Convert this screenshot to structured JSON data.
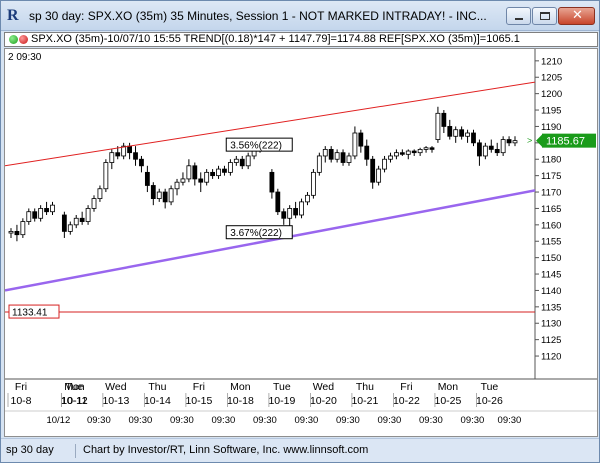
{
  "window": {
    "title": "sp 30 day: SPX.XO (35m) 35 Minutes, Session 1 - NOT MARKED INTRADAY! - INC...",
    "app_icon": "investor-rt-logo-icon"
  },
  "infobar": {
    "text": "SPX.XO (35m)-10/07/10 15:55  TREND[(0.18)*147 + 1147.79]=1174.88  REF[SPX.XO (35m)]=1065.1"
  },
  "footer": {
    "left": "sp 30 day",
    "right": "Chart by Investor/RT, Linn Software, Inc. www.linnsoft.com"
  },
  "chart_data": {
    "type": "candlestick",
    "symbol": "SPX.XO (35m)",
    "ylim": [
      1113,
      1213
    ],
    "y_ticks": [
      1120,
      1125,
      1130,
      1135,
      1140,
      1145,
      1150,
      1155,
      1160,
      1165,
      1170,
      1175,
      1180,
      1185,
      1190,
      1195,
      1200,
      1205,
      1210
    ],
    "top_left_label": "2  09:30",
    "last_price": 1185.67,
    "reference_line": {
      "value": 1133.41,
      "label": "1133.41",
      "color": "#d42020"
    },
    "channel_upper": {
      "start": 1178,
      "end": 1203.5,
      "color": "#e02020"
    },
    "channel_lower": {
      "start": 1140,
      "end": 1170.5,
      "color": "#9966ee"
    },
    "annotations": [
      {
        "text": "3.56%(222)",
        "x": 0.425,
        "y": 1184.3
      },
      {
        "text": "3.67%(222)",
        "x": 0.425,
        "y": 1157.6
      }
    ],
    "days": [
      {
        "dow": "Fri",
        "date": "10-8",
        "tick": "",
        "candles": [
          {
            "o": 1157.5,
            "h": 1159,
            "l": 1156,
            "c": 1158
          },
          {
            "o": 1158,
            "h": 1160,
            "l": 1155,
            "c": 1157
          },
          {
            "o": 1157,
            "h": 1162,
            "l": 1156,
            "c": 1161
          },
          {
            "o": 1161,
            "h": 1165,
            "l": 1160,
            "c": 1164
          },
          {
            "o": 1164,
            "h": 1165,
            "l": 1161,
            "c": 1162
          },
          {
            "o": 1162,
            "h": 1166,
            "l": 1161,
            "c": 1165
          },
          {
            "o": 1165,
            "h": 1167,
            "l": 1163,
            "c": 1164
          },
          {
            "o": 1164,
            "h": 1167,
            "l": 1163,
            "c": 1166
          }
        ]
      },
      {
        "dow": "Mon",
        "date": "10-11",
        "tick": "",
        "candles": []
      },
      {
        "dow": "Tue",
        "date": "10-12",
        "tick": "10/12",
        "candles": [
          {
            "o": 1163,
            "h": 1164,
            "l": 1156,
            "c": 1158
          },
          {
            "o": 1158,
            "h": 1161,
            "l": 1157,
            "c": 1160
          },
          {
            "o": 1160,
            "h": 1163,
            "l": 1159,
            "c": 1162
          },
          {
            "o": 1162,
            "h": 1164,
            "l": 1160,
            "c": 1161
          },
          {
            "o": 1161,
            "h": 1166,
            "l": 1160,
            "c": 1165
          },
          {
            "o": 1165,
            "h": 1169,
            "l": 1164,
            "c": 1168
          },
          {
            "o": 1168,
            "h": 1172,
            "l": 1167,
            "c": 1171
          }
        ]
      },
      {
        "dow": "Wed",
        "date": "10-13",
        "tick": "",
        "candles": [
          {
            "o": 1171,
            "h": 1180,
            "l": 1170,
            "c": 1179
          },
          {
            "o": 1179,
            "h": 1183,
            "l": 1177,
            "c": 1182
          },
          {
            "o": 1182,
            "h": 1184,
            "l": 1180,
            "c": 1181
          },
          {
            "o": 1181,
            "h": 1185,
            "l": 1180,
            "c": 1184
          },
          {
            "o": 1184,
            "h": 1185,
            "l": 1180,
            "c": 1182
          },
          {
            "o": 1182,
            "h": 1184,
            "l": 1178,
            "c": 1180
          },
          {
            "o": 1180,
            "h": 1181,
            "l": 1176,
            "c": 1178
          }
        ]
      },
      {
        "dow": "Thu",
        "date": "10-14",
        "tick": "",
        "candles": [
          {
            "o": 1176,
            "h": 1178,
            "l": 1170,
            "c": 1172
          },
          {
            "o": 1172,
            "h": 1173,
            "l": 1166,
            "c": 1168
          },
          {
            "o": 1168,
            "h": 1171,
            "l": 1167,
            "c": 1170
          },
          {
            "o": 1170,
            "h": 1171,
            "l": 1165,
            "c": 1167
          },
          {
            "o": 1167,
            "h": 1172,
            "l": 1166,
            "c": 1171
          },
          {
            "o": 1171,
            "h": 1174,
            "l": 1169,
            "c": 1173
          },
          {
            "o": 1173,
            "h": 1176,
            "l": 1172,
            "c": 1174
          }
        ]
      },
      {
        "dow": "Fri",
        "date": "10-15",
        "tick": "",
        "candles": [
          {
            "o": 1174,
            "h": 1180,
            "l": 1173,
            "c": 1178
          },
          {
            "o": 1178,
            "h": 1179,
            "l": 1172,
            "c": 1174
          },
          {
            "o": 1174,
            "h": 1176,
            "l": 1170,
            "c": 1173
          },
          {
            "o": 1173,
            "h": 1177,
            "l": 1172,
            "c": 1176
          },
          {
            "o": 1176,
            "h": 1177,
            "l": 1174,
            "c": 1175
          },
          {
            "o": 1175,
            "h": 1178,
            "l": 1174,
            "c": 1177
          },
          {
            "o": 1177,
            "h": 1178,
            "l": 1175,
            "c": 1176
          }
        ]
      },
      {
        "dow": "Mon",
        "date": "10-18",
        "tick": "",
        "candles": [
          {
            "o": 1176,
            "h": 1180,
            "l": 1175,
            "c": 1179
          },
          {
            "o": 1179,
            "h": 1181,
            "l": 1178,
            "c": 1180
          },
          {
            "o": 1180,
            "h": 1181,
            "l": 1177,
            "c": 1178
          },
          {
            "o": 1178,
            "h": 1182,
            "l": 1177,
            "c": 1181
          },
          {
            "o": 1181,
            "h": 1184,
            "l": 1180,
            "c": 1183
          },
          {
            "o": 1183,
            "h": 1185,
            "l": 1182,
            "c": 1184
          },
          {
            "o": 1184,
            "h": 1185,
            "l": 1183,
            "c": 1184.5
          }
        ]
      },
      {
        "dow": "Tue",
        "date": "10-19",
        "tick": "",
        "candles": [
          {
            "o": 1176,
            "h": 1177,
            "l": 1168,
            "c": 1170
          },
          {
            "o": 1170,
            "h": 1171,
            "l": 1163,
            "c": 1164
          },
          {
            "o": 1164,
            "h": 1165,
            "l": 1160,
            "c": 1162
          },
          {
            "o": 1162,
            "h": 1166,
            "l": 1159,
            "c": 1165
          },
          {
            "o": 1165,
            "h": 1167,
            "l": 1162,
            "c": 1163
          },
          {
            "o": 1163,
            "h": 1168,
            "l": 1162,
            "c": 1167
          },
          {
            "o": 1167,
            "h": 1170,
            "l": 1166,
            "c": 1169
          }
        ]
      },
      {
        "dow": "Wed",
        "date": "10-20",
        "tick": "",
        "candles": [
          {
            "o": 1169,
            "h": 1177,
            "l": 1168,
            "c": 1176
          },
          {
            "o": 1176,
            "h": 1182,
            "l": 1175,
            "c": 1181
          },
          {
            "o": 1181,
            "h": 1184,
            "l": 1179,
            "c": 1183
          },
          {
            "o": 1183,
            "h": 1184,
            "l": 1179,
            "c": 1180
          },
          {
            "o": 1180,
            "h": 1183,
            "l": 1179,
            "c": 1182
          },
          {
            "o": 1182,
            "h": 1183,
            "l": 1178,
            "c": 1179
          },
          {
            "o": 1179,
            "h": 1182,
            "l": 1178,
            "c": 1181
          }
        ]
      },
      {
        "dow": "Thu",
        "date": "10-21",
        "tick": "",
        "candles": [
          {
            "o": 1181,
            "h": 1190,
            "l": 1180,
            "c": 1188
          },
          {
            "o": 1188,
            "h": 1189,
            "l": 1182,
            "c": 1184
          },
          {
            "o": 1184,
            "h": 1186,
            "l": 1178,
            "c": 1180
          },
          {
            "o": 1180,
            "h": 1181,
            "l": 1171,
            "c": 1173
          },
          {
            "o": 1173,
            "h": 1178,
            "l": 1172,
            "c": 1177
          },
          {
            "o": 1177,
            "h": 1181,
            "l": 1176,
            "c": 1180
          },
          {
            "o": 1180,
            "h": 1182,
            "l": 1179,
            "c": 1181
          }
        ]
      },
      {
        "dow": "Fri",
        "date": "10-22",
        "tick": "",
        "candles": [
          {
            "o": 1181,
            "h": 1183,
            "l": 1180,
            "c": 1182
          },
          {
            "o": 1182,
            "h": 1183,
            "l": 1181,
            "c": 1181.5
          },
          {
            "o": 1181.5,
            "h": 1183,
            "l": 1180,
            "c": 1182.5
          },
          {
            "o": 1182.5,
            "h": 1183,
            "l": 1181,
            "c": 1182
          },
          {
            "o": 1182,
            "h": 1183.5,
            "l": 1181,
            "c": 1183
          },
          {
            "o": 1183,
            "h": 1184,
            "l": 1182,
            "c": 1183.5
          },
          {
            "o": 1183.5,
            "h": 1184,
            "l": 1182,
            "c": 1183
          }
        ]
      },
      {
        "dow": "Mon",
        "date": "10-25",
        "tick": "",
        "candles": [
          {
            "o": 1186,
            "h": 1196,
            "l": 1185,
            "c": 1194
          },
          {
            "o": 1194,
            "h": 1195,
            "l": 1188,
            "c": 1190
          },
          {
            "o": 1190,
            "h": 1192,
            "l": 1186,
            "c": 1187
          },
          {
            "o": 1187,
            "h": 1190,
            "l": 1185,
            "c": 1189
          },
          {
            "o": 1189,
            "h": 1190,
            "l": 1186,
            "c": 1187
          },
          {
            "o": 1187,
            "h": 1189,
            "l": 1185,
            "c": 1188
          },
          {
            "o": 1188,
            "h": 1189,
            "l": 1184,
            "c": 1185
          }
        ]
      },
      {
        "dow": "Tue",
        "date": "10-26",
        "tick": "",
        "candles": [
          {
            "o": 1185,
            "h": 1186,
            "l": 1178,
            "c": 1181
          },
          {
            "o": 1181,
            "h": 1185,
            "l": 1180,
            "c": 1184
          },
          {
            "o": 1184,
            "h": 1186,
            "l": 1182,
            "c": 1183
          },
          {
            "o": 1183,
            "h": 1185,
            "l": 1181,
            "c": 1182
          },
          {
            "o": 1182,
            "h": 1187,
            "l": 1181,
            "c": 1186
          },
          {
            "o": 1186,
            "h": 1187,
            "l": 1184,
            "c": 1185
          },
          {
            "o": 1185,
            "h": 1187,
            "l": 1184,
            "c": 1185.67
          }
        ]
      }
    ],
    "time_ticks": [
      "09:30",
      "09:30",
      "09:30",
      "09:30",
      "09:30",
      "09:30",
      "09:30",
      "09:30",
      "09:30",
      "09:30",
      "09:30",
      "09:30",
      "09:30"
    ]
  }
}
